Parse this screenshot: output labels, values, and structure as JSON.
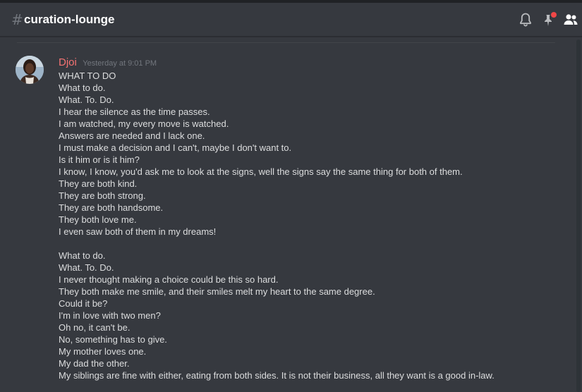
{
  "channel": {
    "hash_glyph": "#",
    "name": "curation-lounge"
  },
  "header_icons": [
    {
      "name": "bell-icon"
    },
    {
      "name": "pin-icon",
      "has_notification": true
    },
    {
      "name": "members-icon"
    }
  ],
  "colors": {
    "background": "#36393f",
    "author": "#f57373",
    "text": "#dcddde",
    "timestamp": "#72767d",
    "notification_dot": "#f04747"
  },
  "message": {
    "author": "Djoi",
    "timestamp": "Yesterday at 9:01 PM",
    "lines": [
      "WHAT TO DO",
      "What to do.",
      "What. To. Do.",
      "I hear the silence as the time passes.",
      "I am watched, my every move is watched.",
      "Answers are needed and I lack one.",
      "I must make a decision and I can't, maybe I don't want to.",
      "Is it him or is it him?",
      "I know, I know, you'd ask me to look at the signs, well the signs say the same thing for both of them.",
      "They are both kind.",
      "They are both strong.",
      "They are both handsome.",
      "They both love me.",
      "I even saw both of them in my dreams!",
      "",
      "What to do.",
      "What. To. Do.",
      "I never thought making a choice could be this so hard.",
      "They both make me smile, and their smiles melt my heart to the same degree.",
      "Could it be?",
      "I'm in love with two men?",
      "Oh no, it can't be.",
      "No, something has to give.",
      "My mother loves one.",
      "My dad the other.",
      "My siblings are fine with either, eating from both sides. It is not their business, all they want is a good in-law."
    ]
  }
}
